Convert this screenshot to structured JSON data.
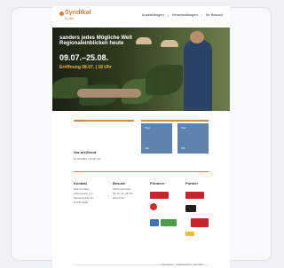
{
  "header": {
    "logo_top": "Das",
    "logo_main": "Syndikat",
    "logo_sub": "Kultur",
    "nav": [
      "Ausstellungen",
      "Veranstaltungen",
      "Ihr Besuch"
    ]
  },
  "hero": {
    "title": "sanders jedes Mögliche Welt Regionaleinblicken heute",
    "dates": "09.07.–25.08.",
    "opening": "Eröffnung 08.07. | 18 Uhr"
  },
  "section": {
    "event_title": "Vor-ort-Event",
    "event_meta": "01.09.2024 | 19:00 Uhr",
    "tiles": [
      {
        "label_top": "Titel",
        "label_bottom": "Info"
      },
      {
        "label_top": "Titel",
        "label_bottom": "Info"
      }
    ]
  },
  "footer": {
    "col1_title": "Kontakt",
    "col1_lines": [
      "Das Syndikat",
      "Kulturverein e.V.",
      "Musterstraße 12",
      "12345 Stadt"
    ],
    "col2_title": "Besuch",
    "col2_lines": [
      "Öffnungszeiten",
      "Mi–So 11–18 Uhr",
      "Eintritt frei"
    ],
    "col3_title": "Förderer",
    "col4_title": "Partner",
    "bottom_links": [
      "Impressum",
      "Datenschutz",
      "Kontakt"
    ]
  },
  "colors": {
    "accent": "#d7803f",
    "tile": "#5e84ad"
  }
}
